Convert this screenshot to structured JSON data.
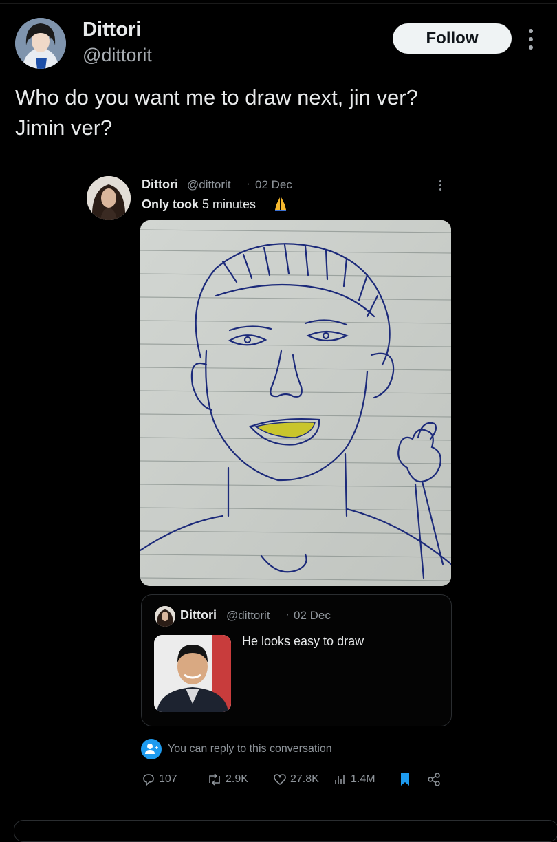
{
  "post": {
    "author_name": "Dittori",
    "author_handle": "@dittorit",
    "follow_label": "Follow",
    "text_line1": "Who do you want me to draw next, jin ver?",
    "text_line2": "Jimin ver?"
  },
  "embedded": {
    "author_name": "Dittori",
    "author_handle": "@dittorit",
    "separator": "·",
    "date": "02 Dec",
    "text_bold": "Only took",
    "text_rest": " 5 minutes"
  },
  "quoted": {
    "author_name": "Dittori",
    "author_handle": "@dittorit",
    "separator": "·",
    "date": "02 Dec",
    "text": "He looks easy to draw"
  },
  "reply_notice": "You can reply to this conversation",
  "actions": {
    "replies": "107",
    "reposts": "2.9K",
    "likes": "27.8K",
    "views": "1.4M"
  },
  "colors": {
    "background": "#000000",
    "accent": "#1d9bf0",
    "muted": "#8e949a"
  },
  "icons": [
    "more-icon",
    "pray-emoji-icon",
    "reply-icon",
    "repost-icon",
    "like-icon",
    "views-icon",
    "bookmark-icon",
    "share-icon",
    "person-add-icon"
  ]
}
